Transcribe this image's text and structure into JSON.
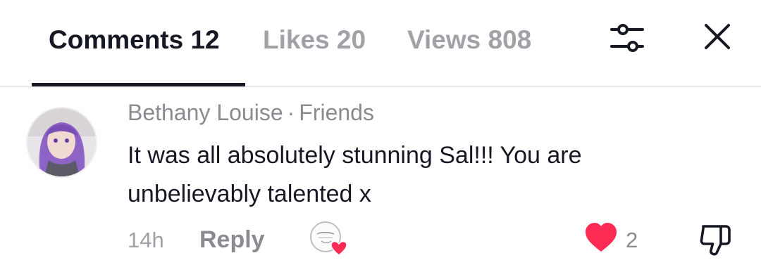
{
  "tabs": [
    {
      "label": "Comments 12",
      "active": true
    },
    {
      "label": "Likes 20",
      "active": false
    },
    {
      "label": "Views 808",
      "active": false
    }
  ],
  "header_icons": {
    "filter": "sliders-icon",
    "close": "close-icon"
  },
  "comment": {
    "author": "Bethany Louise",
    "separator": "·",
    "relation": "Friends",
    "text": "It was all absolutely stunning Sal!!! You are unbelievably talented x",
    "time": "14h",
    "reply_label": "Reply",
    "like_count": "2",
    "like_color": "#fe2c55",
    "liked_by_creator": true
  }
}
